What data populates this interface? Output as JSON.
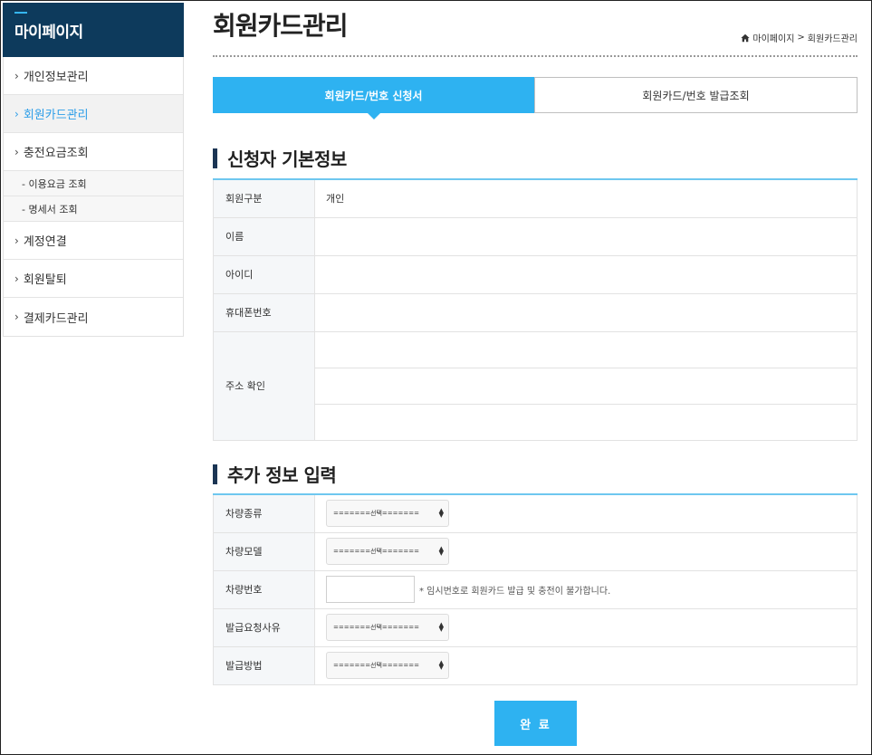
{
  "sidebar": {
    "title": "마이페이지",
    "items": [
      {
        "label": "개인정보관리",
        "active": false
      },
      {
        "label": "회원카드관리",
        "active": true
      },
      {
        "label": "충전요금조회",
        "active": false
      },
      {
        "label": "계정연결",
        "active": false
      },
      {
        "label": "회원탈퇴",
        "active": false
      },
      {
        "label": "결제카드관리",
        "active": false
      }
    ],
    "subitems": [
      {
        "label": "- 이용요금 조회"
      },
      {
        "label": "- 명세서 조회"
      }
    ]
  },
  "header": {
    "title": "회원카드관리",
    "breadcrumb": [
      "마이페이지",
      "회원카드관리"
    ],
    "breadcrumb_separator": ">"
  },
  "tabs": [
    {
      "label": "회원카드/번호 신청서",
      "active": true
    },
    {
      "label": "회원카드/번호 발급조회",
      "active": false
    }
  ],
  "basic_info": {
    "title": "신청자 기본정보",
    "rows": [
      {
        "label": "회원구분",
        "value": "개인"
      },
      {
        "label": "이름",
        "value": ""
      },
      {
        "label": "아이디",
        "value": ""
      },
      {
        "label": "휴대폰번호",
        "value": ""
      },
      {
        "label": "주소 확인",
        "value": ""
      }
    ]
  },
  "extra_info": {
    "title": "추가 정보 입력",
    "select_placeholder": "=======선택=======",
    "rows": [
      {
        "label": "차량종류"
      },
      {
        "label": "차량모델"
      },
      {
        "label": "차량번호",
        "note": "* 임시번호로 회원카드 발급 및 충전이 불가합니다."
      },
      {
        "label": "발급요청사유"
      },
      {
        "label": "발급방법"
      }
    ]
  },
  "submit_label": "완 료",
  "colors": {
    "accent": "#2eb2f1",
    "sidebar_header": "#0d3a5c",
    "active_text": "#2e9ee8",
    "section_bar": "#1b3554"
  }
}
